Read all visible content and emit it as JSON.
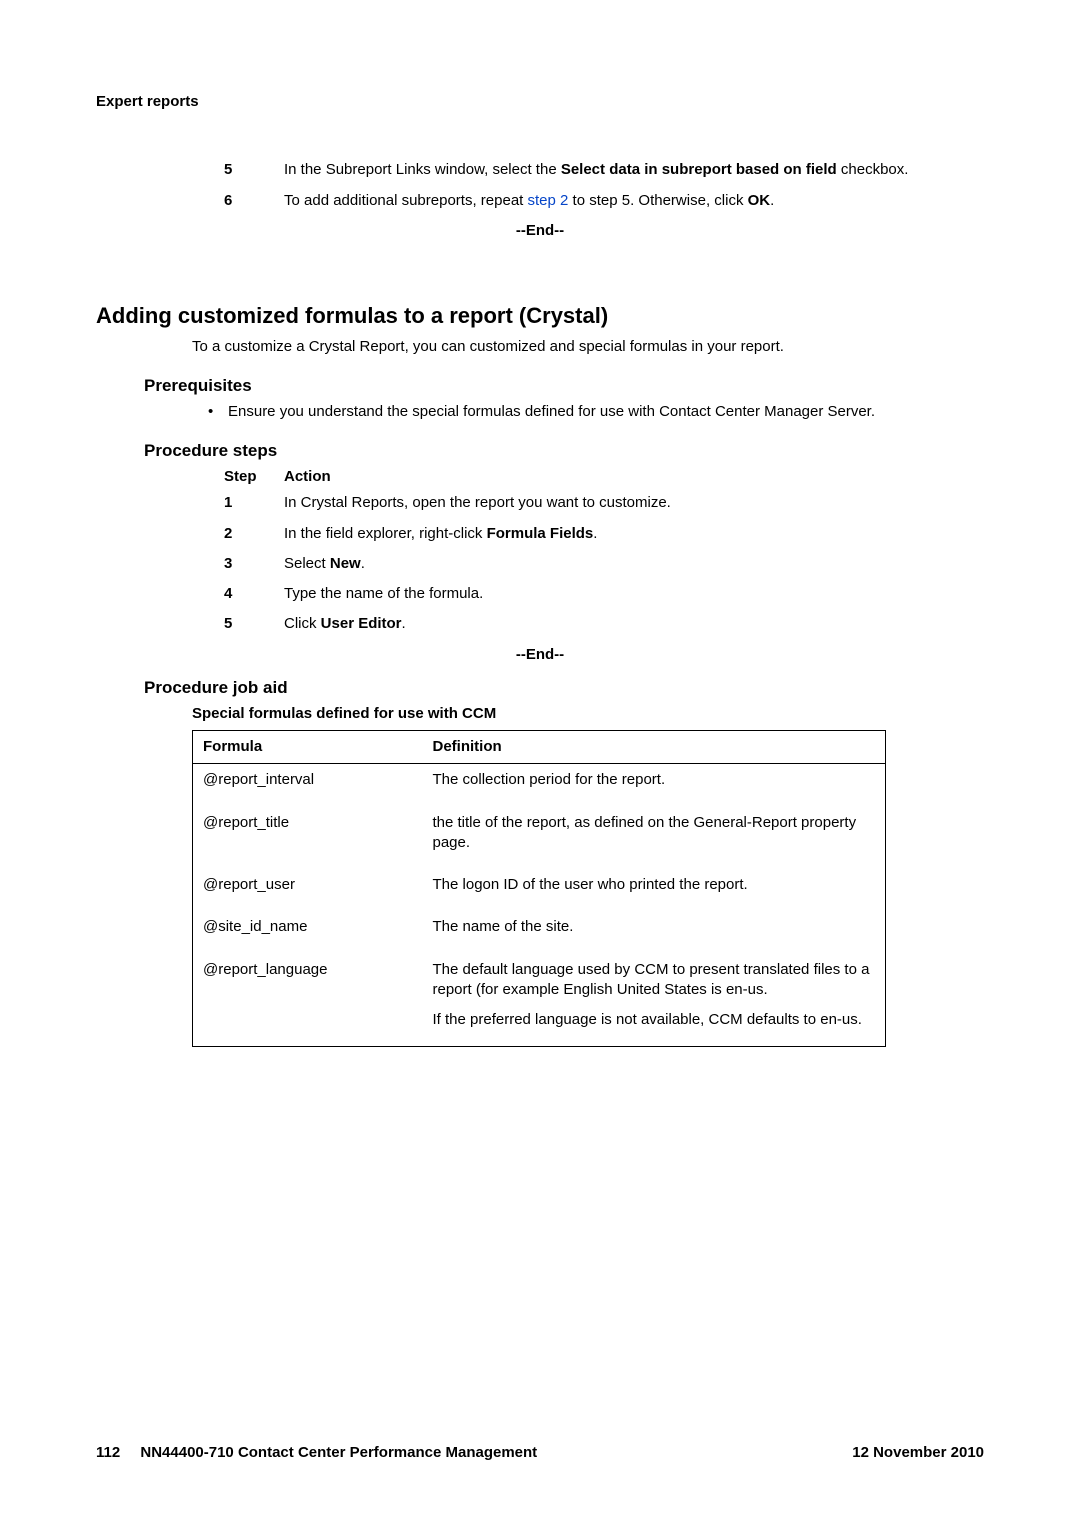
{
  "header": {
    "title": "Expert reports"
  },
  "top_steps": [
    {
      "num": "5",
      "html": "In the Subreport Links window, select the <b>Select data in subreport based on field</b> checkbox."
    },
    {
      "num": "6",
      "html": "To add additional subreports, repeat <span class='link-text'>step 2</span> to step 5. Otherwise, click <b>OK</b>."
    }
  ],
  "end_marker": "--End--",
  "section": {
    "heading": "Adding customized formulas to a report (Crystal)",
    "intro": "To a customize a Crystal Report, you can customized and special formulas in your report."
  },
  "prereq": {
    "heading": "Prerequisites",
    "items": [
      "Ensure you understand the special formulas defined for use with Contact Center Manager Server."
    ]
  },
  "procedure": {
    "heading": "Procedure steps",
    "col_step": "Step",
    "col_action": "Action",
    "steps": [
      {
        "num": "1",
        "html": "In Crystal Reports, open the report you want to customize."
      },
      {
        "num": "2",
        "html": "In the field explorer, right-click <b>Formula Fields</b>."
      },
      {
        "num": "3",
        "html": "Select <b>New</b>."
      },
      {
        "num": "4",
        "html": "Type the name of the formula."
      },
      {
        "num": "5",
        "html": "Click <b>User Editor</b>."
      }
    ]
  },
  "job_aid": {
    "heading": "Procedure job aid",
    "caption": "Special formulas defined for use with CCM",
    "col_formula": "Formula",
    "col_definition": "Definition",
    "rows": [
      {
        "formula": "@report_interval",
        "definition": [
          "The collection period for the report."
        ]
      },
      {
        "formula": "@report_title",
        "definition": [
          "the title of the report, as defined on the General-Report property page."
        ]
      },
      {
        "formula": "@report_user",
        "definition": [
          "The logon ID of the user who printed the report."
        ]
      },
      {
        "formula": "@site_id_name",
        "definition": [
          "The name of the site."
        ]
      },
      {
        "formula": "@report_language",
        "definition": [
          "The default language used by CCM to present translated files to a report (for example English United States is en-us.",
          "If the preferred language is not available, CCM defaults to en-us."
        ]
      }
    ]
  },
  "footer": {
    "page": "112",
    "doc": "NN44400-710 Contact Center Performance Management",
    "date": "12 November 2010"
  }
}
